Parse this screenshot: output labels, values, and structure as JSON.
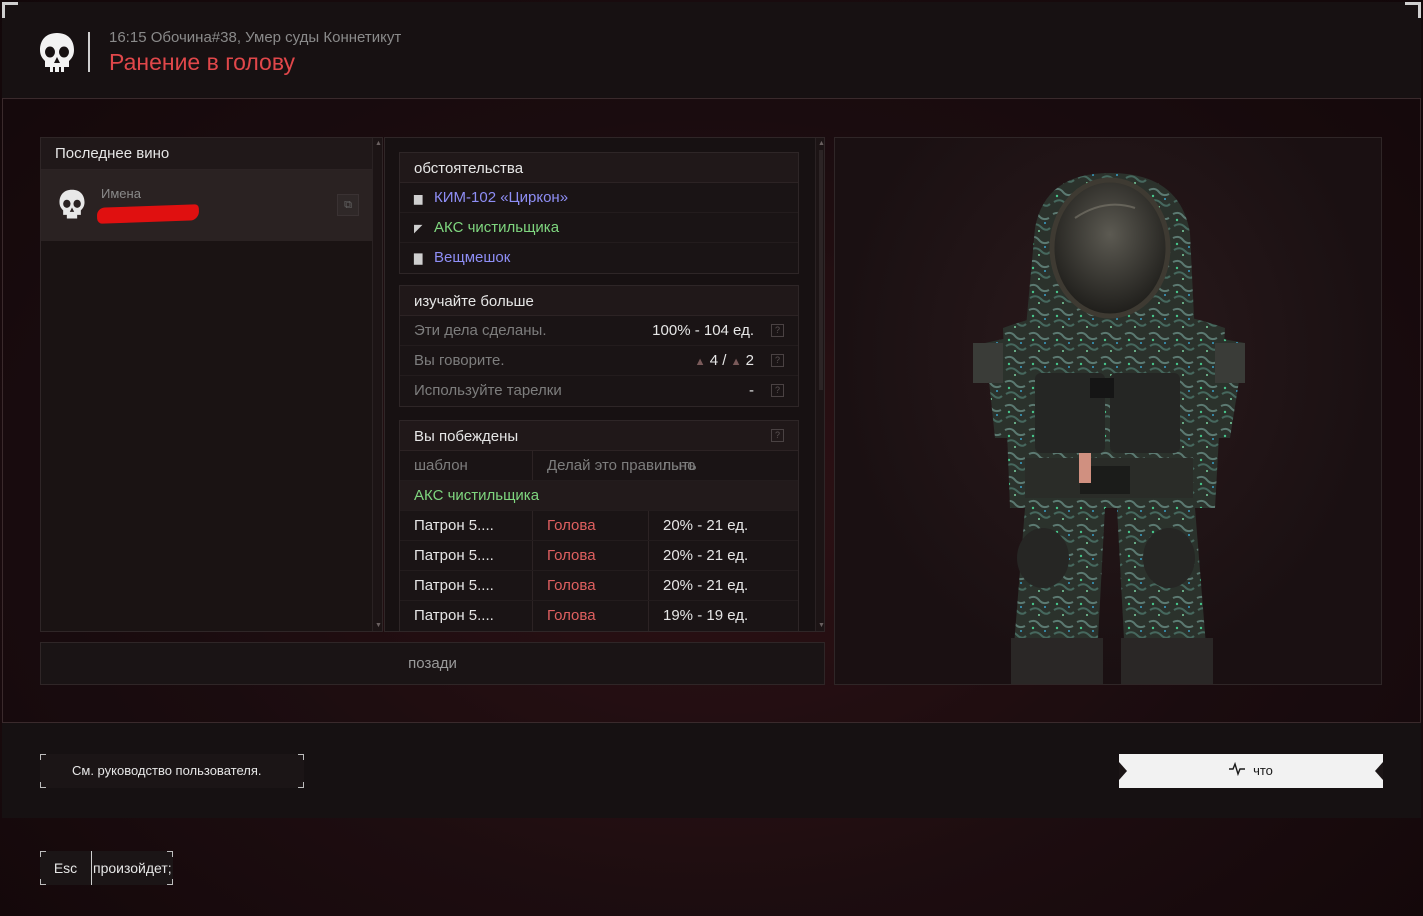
{
  "header": {
    "subtitle": "16:15 Обочина#38, Умер суды Коннетикут",
    "title": "Ранение в голову"
  },
  "left": {
    "heading": "Последнее вино",
    "killer_label": "Имена"
  },
  "circumstances": {
    "heading": "обстоятельства",
    "items": [
      {
        "label": "КИМ-102 «Циркон»",
        "icon": "armor-icon",
        "color": "#8e8ef5"
      },
      {
        "label": "АКС чистильщика",
        "icon": "rifle-icon",
        "color": "#7fd67f"
      },
      {
        "label": "Вещмешок",
        "icon": "backpack-icon",
        "color": "#8e8ef5"
      }
    ]
  },
  "learn_more": {
    "heading": "изучайте больше",
    "rows": [
      {
        "label": "Эти дела сделаны.",
        "value": "100% - 104 ед."
      },
      {
        "label": "Вы говорите.",
        "value_a": "4",
        "sep": "/",
        "value_b": "2"
      },
      {
        "label": "Используйте тарелки",
        "value": "-"
      }
    ]
  },
  "defeated": {
    "heading": "Вы побеждены",
    "col_template": "шаблон",
    "col_do": "Делай это правильно",
    "col_overlap": "пыть",
    "weapon": "АКС чистильщика",
    "rows": [
      {
        "ammo": "Патрон 5....",
        "part": "Голова",
        "dmg": "20% - 21 ед."
      },
      {
        "ammo": "Патрон 5....",
        "part": "Голова",
        "dmg": "20% - 21 ед."
      },
      {
        "ammo": "Патрон 5....",
        "part": "Голова",
        "dmg": "20% - 21 ед."
      },
      {
        "ammo": "Патрон 5....",
        "part": "Голова",
        "dmg": "19% - 19 ед."
      }
    ]
  },
  "back_button": "позади",
  "footer": {
    "guide_button": "См. руководство пользователя.",
    "what_button": "что",
    "esc_key": "Esc",
    "esc_text": "произойдет;"
  }
}
